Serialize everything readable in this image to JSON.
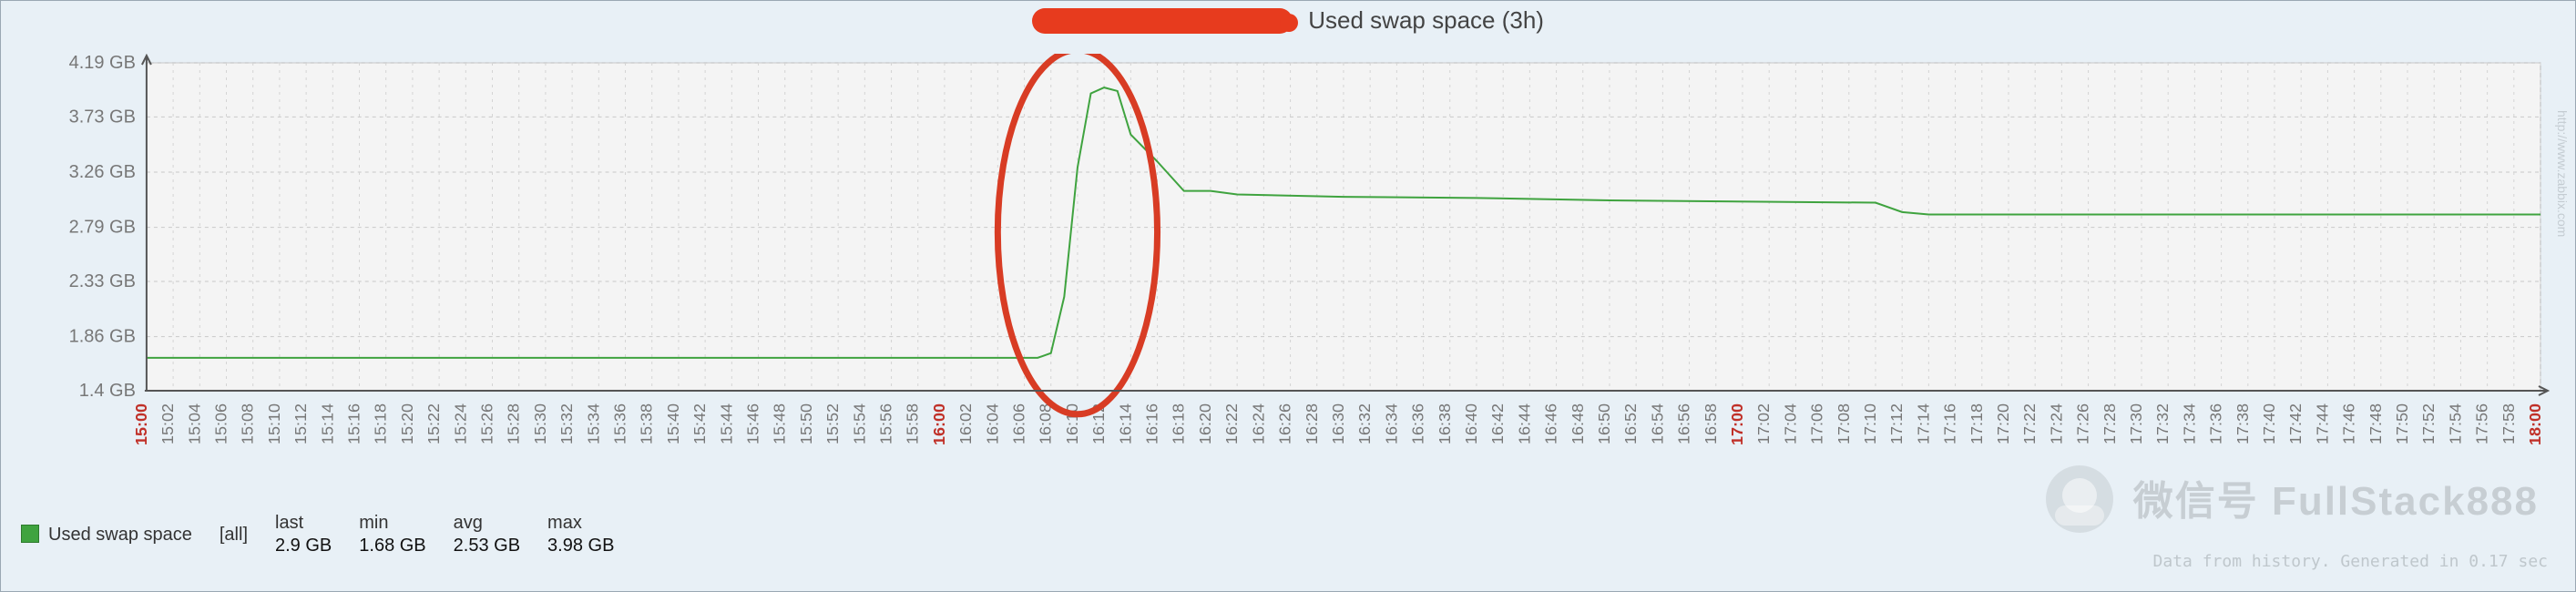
{
  "header": {
    "title_suffix": "Used swap space  (3h)"
  },
  "legend": {
    "metric": "Used swap space",
    "scope": "[all]",
    "last_label": "last",
    "last": "2.9 GB",
    "min_label": "min",
    "min": "1.68 GB",
    "avg_label": "avg",
    "avg": "2.53 GB",
    "max_label": "max",
    "max": "3.98 GB"
  },
  "footer": "Data from history. Generated in 0.17 sec",
  "side_text": "http://www.zabbix.com",
  "watermark_text": "微信号 FullStack888",
  "chart_data": {
    "type": "line",
    "title": "Used swap space (3h)",
    "ylabel": "",
    "xlabel": "",
    "ylim": [
      1.4,
      4.19
    ],
    "yticks": [
      1.4,
      1.86,
      2.33,
      2.79,
      3.26,
      3.73,
      4.19
    ],
    "ytick_labels": [
      "1.4 GB",
      "1.86 GB",
      "2.33 GB",
      "2.79 GB",
      "3.26 GB",
      "3.73 GB",
      "4.19 GB"
    ],
    "xticks_minutes": [
      0,
      2,
      4,
      6,
      8,
      10,
      12,
      14,
      16,
      18,
      20,
      22,
      24,
      26,
      28,
      30,
      32,
      34,
      36,
      38,
      40,
      42,
      44,
      46,
      48,
      50,
      52,
      54,
      56,
      58,
      60,
      62,
      64,
      66,
      68,
      70,
      72,
      74,
      76,
      78,
      80,
      82,
      84,
      86,
      88,
      90,
      92,
      94,
      96,
      98,
      100,
      102,
      104,
      106,
      108,
      110,
      112,
      114,
      116,
      118,
      120,
      122,
      124,
      126,
      128,
      130,
      132,
      134,
      136,
      138,
      140,
      142,
      144,
      146,
      148,
      150,
      152,
      154,
      156,
      158,
      160,
      162,
      164,
      166,
      168,
      170,
      172,
      174,
      176,
      178,
      180
    ],
    "xtick_labels": [
      "15:00",
      "15:02",
      "15:04",
      "15:06",
      "15:08",
      "15:10",
      "15:12",
      "15:14",
      "15:16",
      "15:18",
      "15:20",
      "15:22",
      "15:24",
      "15:26",
      "15:28",
      "15:30",
      "15:32",
      "15:34",
      "15:36",
      "15:38",
      "15:40",
      "15:42",
      "15:44",
      "15:46",
      "15:48",
      "15:50",
      "15:52",
      "15:54",
      "15:56",
      "15:58",
      "16:00",
      "16:02",
      "16:04",
      "16:06",
      "16:08",
      "16:10",
      "16:12",
      "16:14",
      "16:16",
      "16:18",
      "16:20",
      "16:22",
      "16:24",
      "16:26",
      "16:28",
      "16:30",
      "16:32",
      "16:34",
      "16:36",
      "16:38",
      "16:40",
      "16:42",
      "16:44",
      "16:46",
      "16:48",
      "16:50",
      "16:52",
      "16:54",
      "16:56",
      "16:58",
      "17:00",
      "17:02",
      "17:04",
      "17:06",
      "17:08",
      "17:10",
      "17:12",
      "17:14",
      "17:16",
      "17:18",
      "17:20",
      "17:22",
      "17:24",
      "17:26",
      "17:28",
      "17:30",
      "17:32",
      "17:34",
      "17:36",
      "17:38",
      "17:40",
      "17:42",
      "17:44",
      "17:46",
      "17:48",
      "17:50",
      "17:52",
      "17:54",
      "17:56",
      "17:58",
      "18:00"
    ],
    "hour_indices": [
      0,
      30,
      60,
      90
    ],
    "series": [
      {
        "name": "Used swap space",
        "color": "#3fa33f",
        "x": [
          0,
          67,
          68,
          69,
          70,
          71,
          72,
          73,
          74,
          76,
          78,
          80,
          82,
          90,
          100,
          110,
          130,
          132,
          134,
          140,
          150,
          160,
          170,
          180
        ],
        "y": [
          1.68,
          1.68,
          1.72,
          2.2,
          3.3,
          3.93,
          3.98,
          3.95,
          3.58,
          3.35,
          3.1,
          3.1,
          3.07,
          3.05,
          3.04,
          3.02,
          3.0,
          2.92,
          2.9,
          2.9,
          2.9,
          2.9,
          2.9,
          2.9
        ]
      }
    ],
    "annotation_oval": {
      "cx_min": 70,
      "cy_gb": 2.75,
      "rx_min": 6,
      "ry_gb": 1.55
    }
  }
}
